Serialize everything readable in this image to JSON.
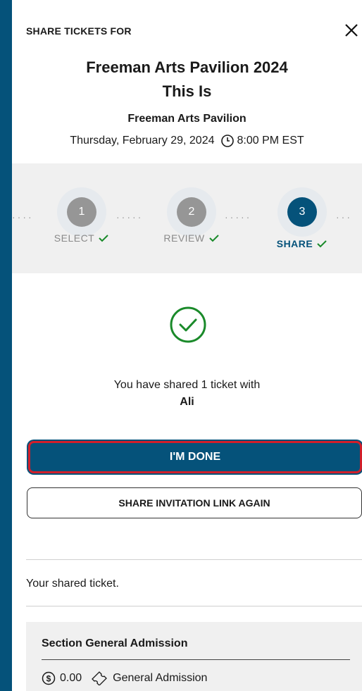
{
  "header": {
    "label": "SHARE TICKETS FOR",
    "close_icon": "close-icon"
  },
  "event": {
    "title_line1": "Freeman Arts Pavilion 2024",
    "title_line2": "This Is",
    "venue": "Freeman Arts Pavilion",
    "date": "Thursday, February 29, 2024",
    "time": "8:00 PM EST"
  },
  "stepper": {
    "steps": [
      {
        "number": "1",
        "label": "SELECT",
        "status": "done"
      },
      {
        "number": "2",
        "label": "REVIEW",
        "status": "done"
      },
      {
        "number": "3",
        "label": "SHARE",
        "status": "active"
      }
    ]
  },
  "confirmation": {
    "message": "You have shared 1 ticket with",
    "recipient": "Ali"
  },
  "buttons": {
    "done": "I'M DONE",
    "share_again": "SHARE INVITATION LINK AGAIN"
  },
  "shared_ticket": {
    "heading": "Your shared ticket.",
    "section": "Section General Admission",
    "price": "0.00",
    "type": "General Admission"
  },
  "colors": {
    "brand": "#05527a",
    "success": "#1a8a2a",
    "highlight": "#d21f2a"
  }
}
